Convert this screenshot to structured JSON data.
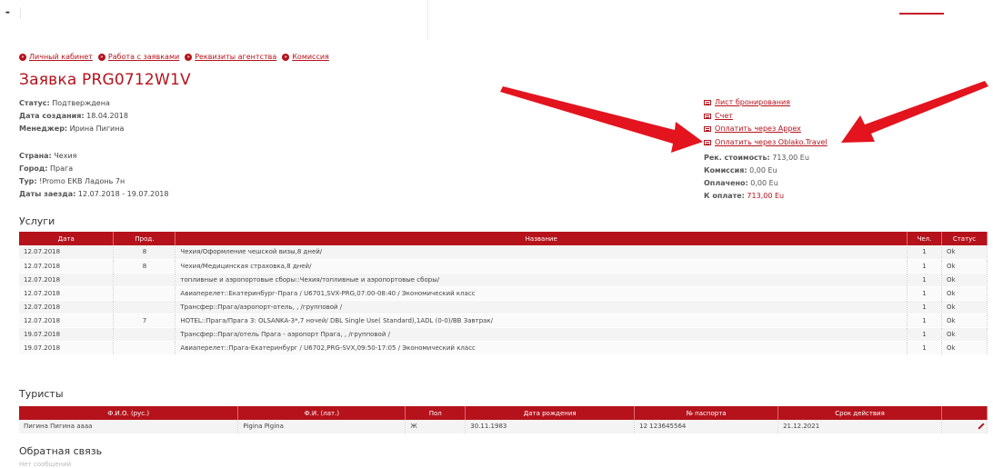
{
  "topbar": {
    "logo_text": "▬"
  },
  "nav": [
    {
      "label": "Личный кабинет"
    },
    {
      "label": "Работа с заявками"
    },
    {
      "label": "Реквизиты агентства"
    },
    {
      "label": "Комиссия"
    }
  ],
  "title": "Заявка PRG0712W1V",
  "info1": {
    "status_label": "Статус:",
    "status": "Подтверждена",
    "created_label": "Дата создания:",
    "created": "18.04.2018",
    "manager_label": "Менеджер:",
    "manager": "Ирина Пигина"
  },
  "info2": {
    "country_label": "Страна:",
    "country": "Чехия",
    "city_label": "Город:",
    "city": "Прага",
    "tour_label": "Тур:",
    "tour": "!Promo ЕКВ Ладонь 7н",
    "dates_label": "Даты заезда:",
    "dates": "12.07.2018 - 19.07.2018"
  },
  "doclinks": [
    {
      "label": "Лист бронирования"
    },
    {
      "label": "Счет"
    },
    {
      "label": "Оплатить через Appex"
    },
    {
      "label": "Оплатить через Oblako.Travel"
    }
  ],
  "money": {
    "price_label": "Рек. стоимость:",
    "price": "713,00 Eu",
    "commission_label": "Комиссия:",
    "commission": "0,00 Eu",
    "paid_label": "Оплачено:",
    "paid": "0,00 Eu",
    "due_label": "К оплате:",
    "due": "713,00 Eu"
  },
  "services": {
    "heading": "Услуги",
    "columns": [
      "Дата",
      "Прод.",
      "Название",
      "Чел.",
      "Статус"
    ],
    "rows": [
      [
        "12.07.2018",
        "8",
        "Чехия/Оформление чешской визы,8 дней/",
        "1",
        "Ok"
      ],
      [
        "12.07.2018",
        "8",
        "Чехия/Медицинская страховка,8 дней/",
        "1",
        "Ok"
      ],
      [
        "12.07.2018",
        "",
        "топливные и аэропортовые сборы::Чехия/топливные и аэропортовые сборы/",
        "1",
        "Ok"
      ],
      [
        "12.07.2018",
        "",
        "Авиаперелет::Екатеринбург-Прага / U6701,SVX-PRG,07:00-08:40 / Экономический класс",
        "1",
        "Ok"
      ],
      [
        "12.07.2018",
        "",
        "Трансфер::Прага/аэропорт-отель, , /групповой /",
        "1",
        "Ok"
      ],
      [
        "12.07.2018",
        "7",
        "HOTEL::Прага/Прага 3: OLSANKA-3*,7 ночей/ DBL Single Use( Standard),1ADL (0-0)/BB Завтрак/",
        "1",
        "Ok"
      ],
      [
        "19.07.2018",
        "",
        "Трансфер::Прага/отель Прага - аэропорт Прага, , /групповой /",
        "1",
        "Ok"
      ],
      [
        "19.07.2018",
        "",
        "Авиаперелет::Прага-Екатеринбург / U6702,PRG-SVX,09:50-17:05 / Экономический класс",
        "1",
        "Ok"
      ]
    ]
  },
  "tourists": {
    "heading": "Туристы",
    "columns": [
      "Ф.И.О. (рус.)",
      "Ф.И. (лат.)",
      "Пол",
      "Дата рождения",
      "№ паспорта",
      "Срок действия",
      ""
    ],
    "rows": [
      [
        "Пигина Пигина аааа",
        "Pigina Pigina",
        "Ж",
        "30.11.1983",
        "12 123645564",
        "21.12.2021",
        ""
      ]
    ]
  },
  "feedback": {
    "heading": "Обратная связь",
    "hint": "Нет сообщений"
  },
  "colors": {
    "accent": "#b5121b",
    "arrow": "#e3141e"
  }
}
